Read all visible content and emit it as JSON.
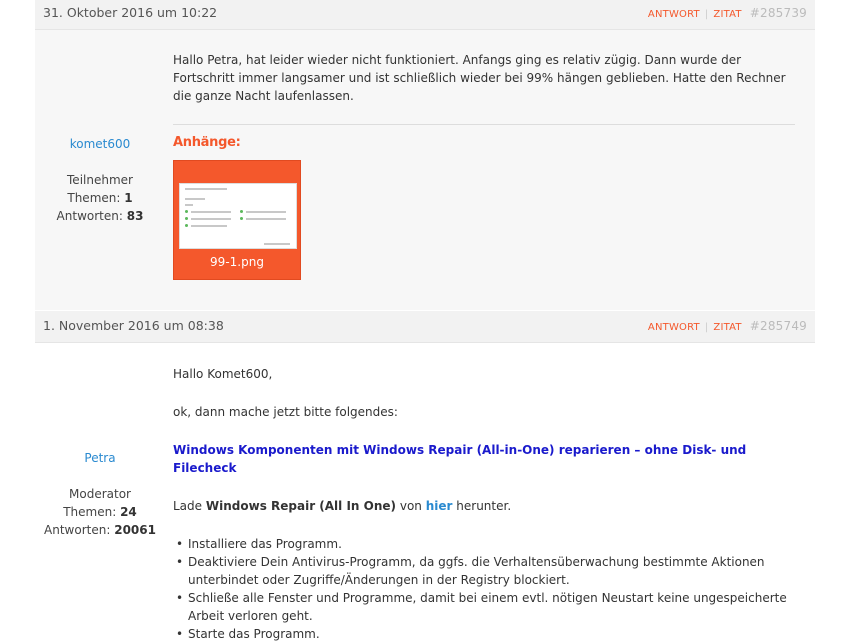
{
  "replies": [
    {
      "date": "31. Oktober 2016 um 10:22",
      "actions": {
        "reply": "ANTWORT",
        "quote": "ZITAT"
      },
      "permalink": "#285739",
      "author": {
        "name": "komet600",
        "role": "Teilnehmer",
        "topics_label": "Themen:",
        "topics": "1",
        "replies_label": "Antworten:",
        "replies": "83"
      },
      "text": "Hallo Petra, hat leider wieder nicht funktioniert. Anfangs ging es relativ zügig. Dann wurde der Fortschritt immer langsamer und ist schließlich wieder bei 99% hängen geblieben. Hatte den Rechner die ganze Nacht laufenlassen.",
      "attachments_label": "Anhänge:",
      "attachment_name": "99-1.png"
    },
    {
      "date": "1. November 2016 um 08:38",
      "actions": {
        "reply": "ANTWORT",
        "quote": "ZITAT"
      },
      "permalink": "#285749",
      "author": {
        "name": "Petra",
        "role": "Moderator",
        "topics_label": "Themen:",
        "topics": "24",
        "replies_label": "Antworten:",
        "replies": "20061"
      },
      "greeting": "Hallo Komet600,",
      "intro": "ok, dann mache jetzt bitte folgendes:",
      "guide_link": "Windows Komponenten mit Windows Repair (All-in-One) reparieren – ohne Disk- und Filecheck",
      "download": {
        "prefix": "Lade",
        "product": "Windows Repair (All In One)",
        "middle": "von",
        "link": "hier",
        "suffix": "herunter."
      },
      "steps": [
        "Installiere das Programm.",
        "Deaktiviere Dein Antivirus-Programm, da ggfs. die Verhaltensüberwachung bestimmte Aktionen unterbindet oder Zugriffe/Änderungen in der Registry blockiert.",
        "Schließe alle Fenster und Programme, damit bei einem evtl. nötigen Neustart keine ungespeicherte Arbeit verloren geht.",
        "Starte das Programm."
      ]
    }
  ]
}
